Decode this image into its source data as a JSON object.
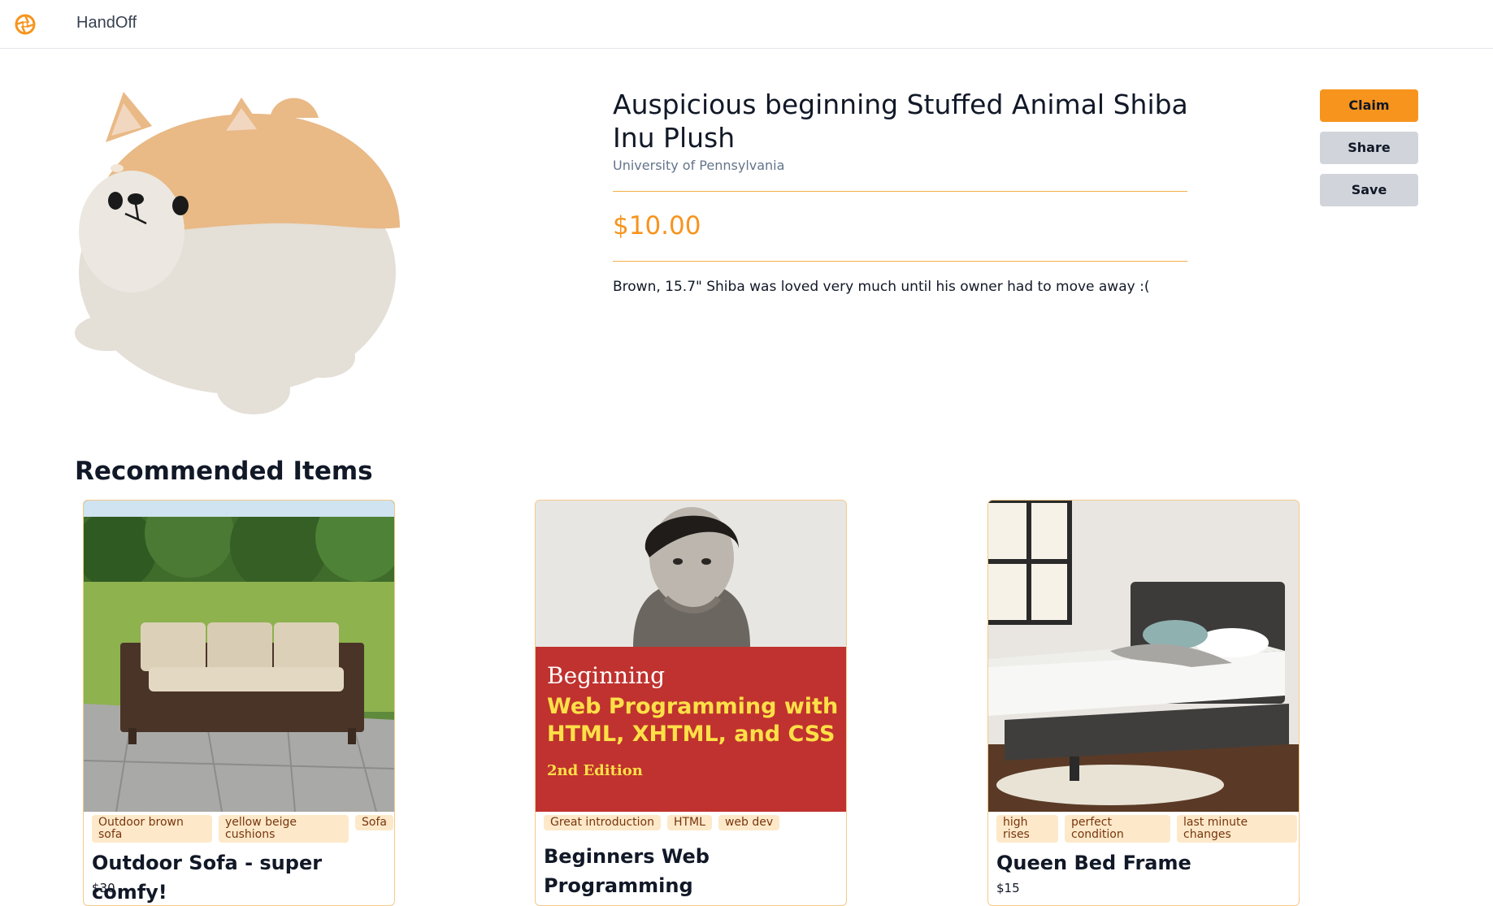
{
  "header": {
    "logo_icon": "aperture-logo-icon",
    "brand": "HandOff",
    "accent": "#f7941d"
  },
  "product": {
    "image": "shiba-plush-photo",
    "title": "Auspicious beginning Stuffed Animal Shiba Inu Plush",
    "location": "University of Pennsylvania",
    "price": "$10.00",
    "description": "Brown, 15.7\" Shiba was loved very much until his owner had to move away :("
  },
  "actions": {
    "claim": "Claim",
    "share": "Share",
    "save": "Save"
  },
  "recommended": {
    "title": "Recommended Items",
    "items": [
      {
        "image": "outdoor-sofa-photo",
        "tags": [
          "Outdoor brown sofa",
          "yellow beige cushions",
          "Sofa"
        ],
        "name": "Outdoor Sofa - super comfy!",
        "price": "$30"
      },
      {
        "image": "book-cover-photo",
        "tags": [
          "Great introduction",
          "HTML",
          "web dev"
        ],
        "name": "Beginners Web Programming",
        "price": "",
        "cover_text": {
          "line1": "Beginning",
          "line2": "Web Programming with",
          "line3": "HTML, XHTML, and CSS",
          "line4": "2nd Edition"
        }
      },
      {
        "image": "bed-frame-photo",
        "tags": [
          "high rises",
          "perfect condition",
          "last minute changes"
        ],
        "name": "Queen Bed Frame",
        "price": "$15"
      }
    ]
  }
}
